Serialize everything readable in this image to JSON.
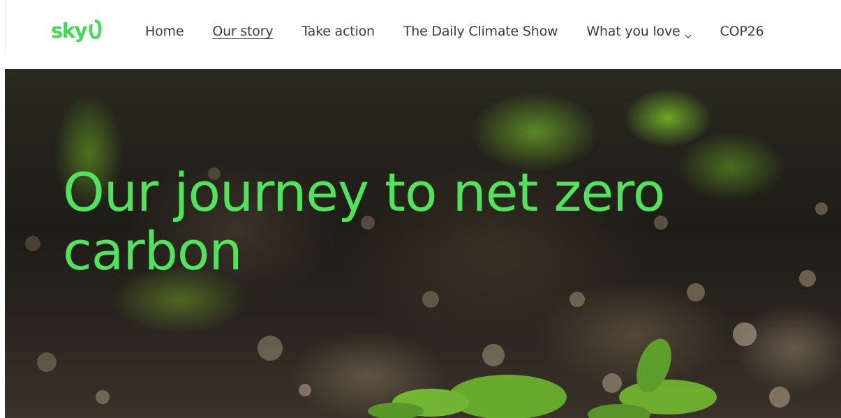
{
  "header": {
    "logo_text": "sky",
    "nav": [
      {
        "label": "Home",
        "active": false
      },
      {
        "label": "Our story",
        "active": true
      },
      {
        "label": "Take action",
        "active": false
      },
      {
        "label": "The Daily Climate Show",
        "active": false
      },
      {
        "label": "What you love",
        "active": false,
        "has_dropdown": true
      },
      {
        "label": "COP26",
        "active": false
      }
    ]
  },
  "hero": {
    "title": "Our journey to net zero carbon"
  },
  "colors": {
    "brand_green": "#42d850",
    "hero_title": "#52e35d",
    "nav_text": "#3b3b3b"
  },
  "icons": {
    "logo_mark": "zero-ring-icon",
    "dropdown": "chevron-down-icon"
  }
}
